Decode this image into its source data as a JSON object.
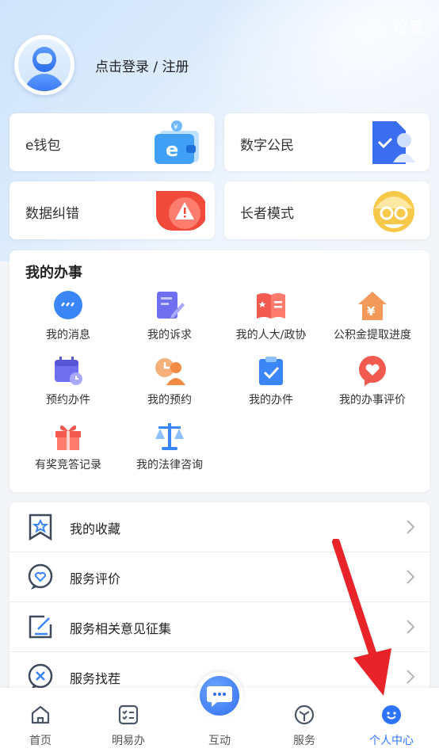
{
  "header": {
    "settings_label": "设置",
    "login_label": "点击登录 / 注册"
  },
  "quick_cards": [
    {
      "label": "e钱包",
      "icon": "wallet-icon"
    },
    {
      "label": "数字公民",
      "icon": "digital-id-icon"
    },
    {
      "label": "数据纠错",
      "icon": "warning-icon"
    },
    {
      "label": "长者模式",
      "icon": "elder-icon"
    }
  ],
  "my_affairs": {
    "title": "我的办事",
    "items": [
      {
        "label": "我的消息",
        "icon": "message-icon"
      },
      {
        "label": "我的诉求",
        "icon": "appeal-edit-icon"
      },
      {
        "label": "我的人大/政协",
        "icon": "congress-book-icon"
      },
      {
        "label": "公积金提取进度",
        "icon": "housing-fund-icon"
      },
      {
        "label": "预约办件",
        "icon": "calendar-clock-icon"
      },
      {
        "label": "我的预约",
        "icon": "appointment-person-icon"
      },
      {
        "label": "我的办件",
        "icon": "clipboard-check-icon"
      },
      {
        "label": "我的办事评价",
        "icon": "heart-chat-icon"
      },
      {
        "label": "有奖竞答记录",
        "icon": "gift-icon"
      },
      {
        "label": "我的法律咨询",
        "icon": "scale-icon"
      }
    ]
  },
  "list_rows": [
    {
      "label": "我的收藏",
      "icon": "star-bookmark-icon"
    },
    {
      "label": "服务评价",
      "icon": "heart-bubble-icon"
    },
    {
      "label": "服务相关意见征集",
      "icon": "edit-square-icon"
    },
    {
      "label": "服务找茬",
      "icon": "close-bubble-icon"
    }
  ],
  "tabbar": {
    "tabs": [
      {
        "label": "首页",
        "icon": "home-icon"
      },
      {
        "label": "明易办",
        "icon": "checklist-icon"
      },
      {
        "label": "互动",
        "icon": "chat-bubble-icon"
      },
      {
        "label": "服务",
        "icon": "cube-icon"
      },
      {
        "label": "个人中心",
        "icon": "smile-icon",
        "active": true
      }
    ]
  },
  "colors": {
    "accent": "#2f74ff",
    "annotation_arrow": "#e8232a"
  }
}
